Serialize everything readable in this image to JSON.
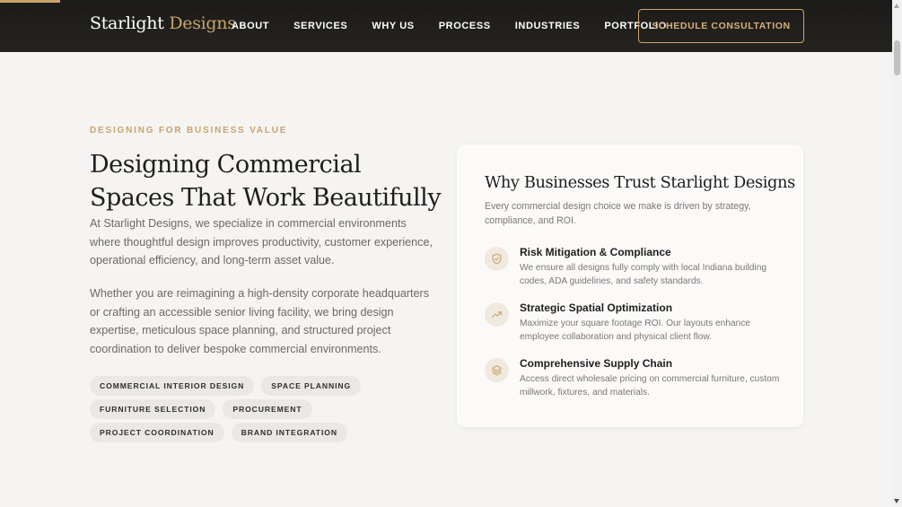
{
  "header": {
    "logo_primary": "Starlight",
    "logo_accent": "Designs",
    "nav": [
      "ABOUT",
      "SERVICES",
      "WHY US",
      "PROCESS",
      "INDUSTRIES",
      "PORTFOLIO"
    ],
    "cta_label": "SCHEDULE CONSULTATION"
  },
  "hero": {
    "eyebrow": "DESIGNING FOR BUSINESS VALUE",
    "title": "Designing Commercial Spaces That Work Beautifully",
    "paragraph1": "At Starlight Designs, we specialize in commercial environments where thoughtful design improves productivity, customer experience, operational efficiency, and long-term asset value.",
    "paragraph2": "Whether you are reimagining a high-density corporate headquarters or crafting an accessible senior living facility, we bring design expertise, meticulous space planning, and structured project coordination to deliver bespoke commercial environments.",
    "tags": [
      "COMMERCIAL INTERIOR DESIGN",
      "SPACE PLANNING",
      "FURNITURE SELECTION",
      "PROCUREMENT",
      "PROJECT COORDINATION",
      "BRAND INTEGRATION"
    ]
  },
  "card": {
    "title": "Why Businesses Trust Starlight Designs",
    "subtitle": "Every commercial design choice we make is driven by strategy, compliance, and ROI.",
    "features": [
      {
        "icon": "shield-icon",
        "title": "Risk Mitigation & Compliance",
        "desc": "We ensure all designs fully comply with local Indiana building codes, ADA guidelines, and safety standards."
      },
      {
        "icon": "trend-up-icon",
        "title": "Strategic Spatial Optimization",
        "desc": "Maximize your square footage ROI. Our layouts enhance employee collaboration and physical client flow."
      },
      {
        "icon": "layers-icon",
        "title": "Comprehensive Supply Chain",
        "desc": "Access direct wholesale pricing on commercial furniture, custom millwork, fixtures, and materials."
      }
    ]
  },
  "colors": {
    "accent": "#c9a46a",
    "header_bg": "#1f1e1c",
    "page_bg": "#f5f4f2"
  }
}
